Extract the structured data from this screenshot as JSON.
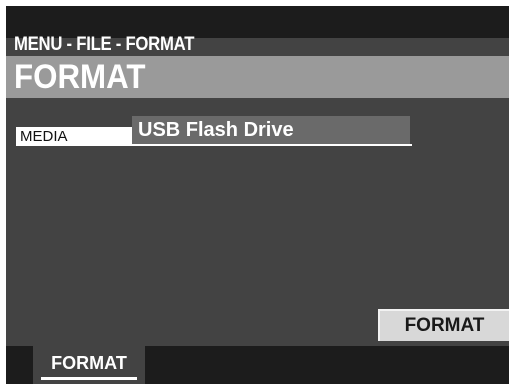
{
  "header": {
    "breadcrumb": "MENU - FILE - FORMAT",
    "title": "FORMAT"
  },
  "media": {
    "label": "MEDIA",
    "value": "USB Flash Drive"
  },
  "actions": {
    "format_label": "FORMAT"
  },
  "footer": {
    "tab_label": "FORMAT"
  },
  "colors": {
    "screen_bg": "#434343",
    "title_bar": "#9a9a9a",
    "value_box": "#6a6a6a",
    "button_bg": "#d8d8d8",
    "bar_bg": "#1c1c1c"
  }
}
